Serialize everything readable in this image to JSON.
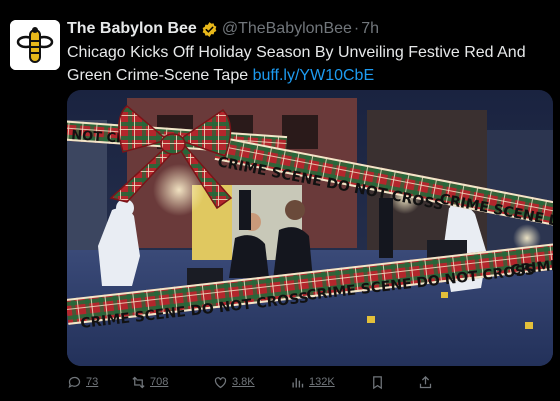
{
  "tweet": {
    "author_name": "The Babylon Bee",
    "handle": "@TheBabylonBee",
    "separator": "·",
    "time": "7h",
    "text": "Chicago Kicks Off Holiday Season By Unveiling Festive Red And Green Crime-Scene Tape",
    "link": "buff.ly/YW10CbE"
  },
  "media": {
    "tape_texts": [
      "NOT CROSS",
      "CRIME SCENE DO NOT CROSS",
      "CRIME SCENE DO",
      "CRIME SCENE DO NOT CROSS",
      "CRIME SCENE DO NOT CROSS",
      "CRIME"
    ],
    "colors": {
      "tape_red": "#c0262b",
      "tape_green": "#1e6b3a",
      "tape_cream": "#f2e6c9"
    }
  },
  "actions": {
    "replies": "73",
    "reposts": "708",
    "likes": "3.8K",
    "views": "132K"
  },
  "icons": [
    "babylon-bee-logo-icon",
    "verified-badge-icon",
    "reply-icon",
    "repost-icon",
    "like-icon",
    "views-icon",
    "bookmark-icon",
    "share-icon"
  ],
  "colors": {
    "background": "#000000",
    "text": "#e7e9ea",
    "muted": "#71767b",
    "link": "#1d9bf0",
    "badge": "#e8b81a"
  }
}
